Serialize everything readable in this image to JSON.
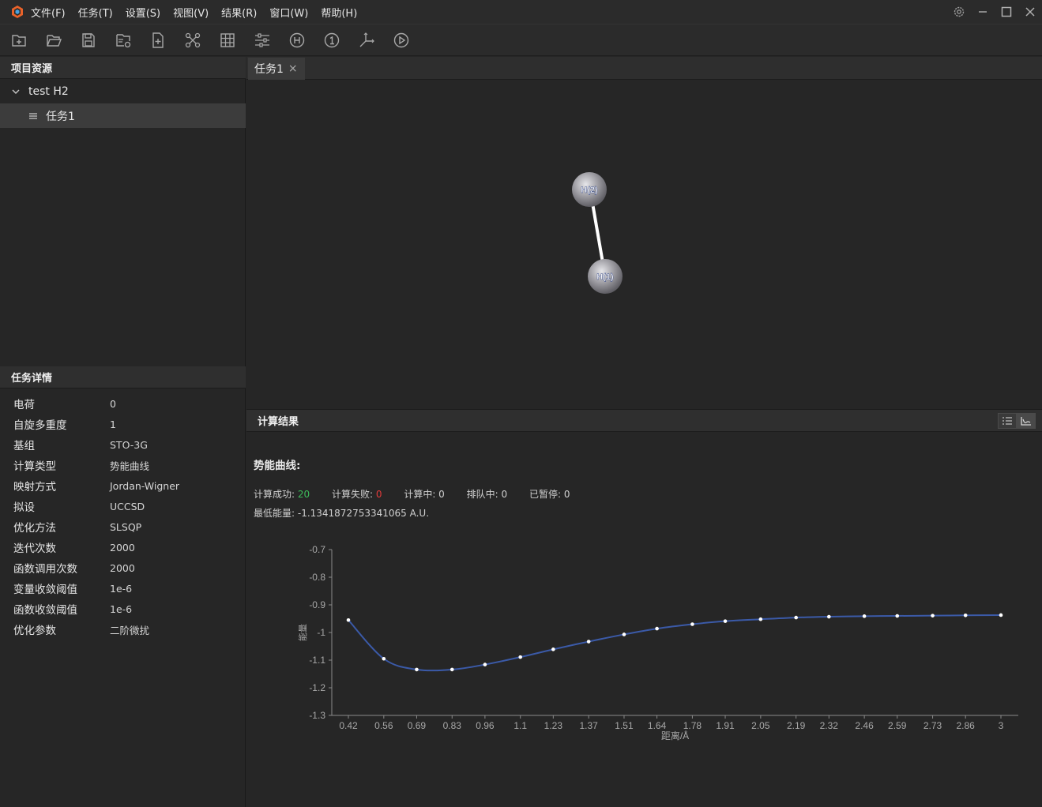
{
  "titlebar": {
    "menus": [
      "文件(F)",
      "任务(T)",
      "设置(S)",
      "视图(V)",
      "结果(R)",
      "窗口(W)",
      "帮助(H)"
    ]
  },
  "toolbar": {
    "icons": [
      "new-project-icon",
      "open-folder-icon",
      "save-icon",
      "save-as-icon",
      "new-file-icon",
      "molecule-graph-icon",
      "table-icon",
      "settings-sliders-icon",
      "hydrogen-icon",
      "one-icon",
      "axis-icon",
      "run-icon"
    ]
  },
  "project_panel": {
    "title": "项目资源",
    "root": "test H2",
    "task": "任务1"
  },
  "detail_panel": {
    "title": "任务详情",
    "rows": [
      {
        "key": "电荷",
        "value": "0"
      },
      {
        "key": "自旋多重度",
        "value": "1"
      },
      {
        "key": "基组",
        "value": "STO-3G"
      },
      {
        "key": "计算类型",
        "value": "势能曲线"
      },
      {
        "key": "映射方式",
        "value": "Jordan-Wigner"
      },
      {
        "key": "拟设",
        "value": "UCCSD"
      },
      {
        "key": "优化方法",
        "value": "SLSQP"
      },
      {
        "key": "迭代次数",
        "value": "2000"
      },
      {
        "key": "函数调用次数",
        "value": "2000"
      },
      {
        "key": "变量收敛阈值",
        "value": "1e-6"
      },
      {
        "key": "函数收敛阈值",
        "value": "1e-6"
      },
      {
        "key": "优化参数",
        "value": "二阶微扰"
      }
    ]
  },
  "tab": {
    "label": "任务1",
    "close": "×"
  },
  "molecule": {
    "atoms": [
      "H(2)",
      "H(1)"
    ]
  },
  "results": {
    "title": "计算结果",
    "curve_title": "势能曲线:",
    "success_label": "计算成功:",
    "success_value": "20",
    "fail_label": "计算失败:",
    "fail_value": "0",
    "running": "计算中: 0",
    "queued": "排队中: 0",
    "paused": "已暂停: 0",
    "min_energy": "最低能量: -1.1341872753341065 A.U."
  },
  "chart_data": {
    "type": "line",
    "xlabel": "距离/Å",
    "ylabel": "能量",
    "ylim": [
      -1.3,
      -0.7
    ],
    "yticks": [
      "-0.7",
      "-0.8",
      "-0.9",
      "-1",
      "-1.1",
      "-1.2",
      "-1.3"
    ],
    "xticks": [
      "0.42",
      "0.56",
      "0.69",
      "0.83",
      "0.96",
      "1.1",
      "1.23",
      "1.37",
      "1.51",
      "1.64",
      "1.78",
      "1.91",
      "2.05",
      "2.19",
      "2.32",
      "2.46",
      "2.59",
      "2.73",
      "2.86",
      "3"
    ],
    "x": [
      0.42,
      0.56,
      0.69,
      0.83,
      0.96,
      1.1,
      1.23,
      1.37,
      1.51,
      1.64,
      1.78,
      1.91,
      2.05,
      2.19,
      2.32,
      2.46,
      2.59,
      2.73,
      2.86,
      3.0
    ],
    "y": [
      -0.955,
      -1.095,
      -1.134,
      -1.134,
      -1.116,
      -1.089,
      -1.061,
      -1.033,
      -1.007,
      -0.986,
      -0.97,
      -0.959,
      -0.952,
      -0.946,
      -0.943,
      -0.941,
      -0.94,
      -0.939,
      -0.938,
      -0.937
    ],
    "line_color": "#3b5aa8",
    "point_color": "#ffffff",
    "grid": false
  }
}
